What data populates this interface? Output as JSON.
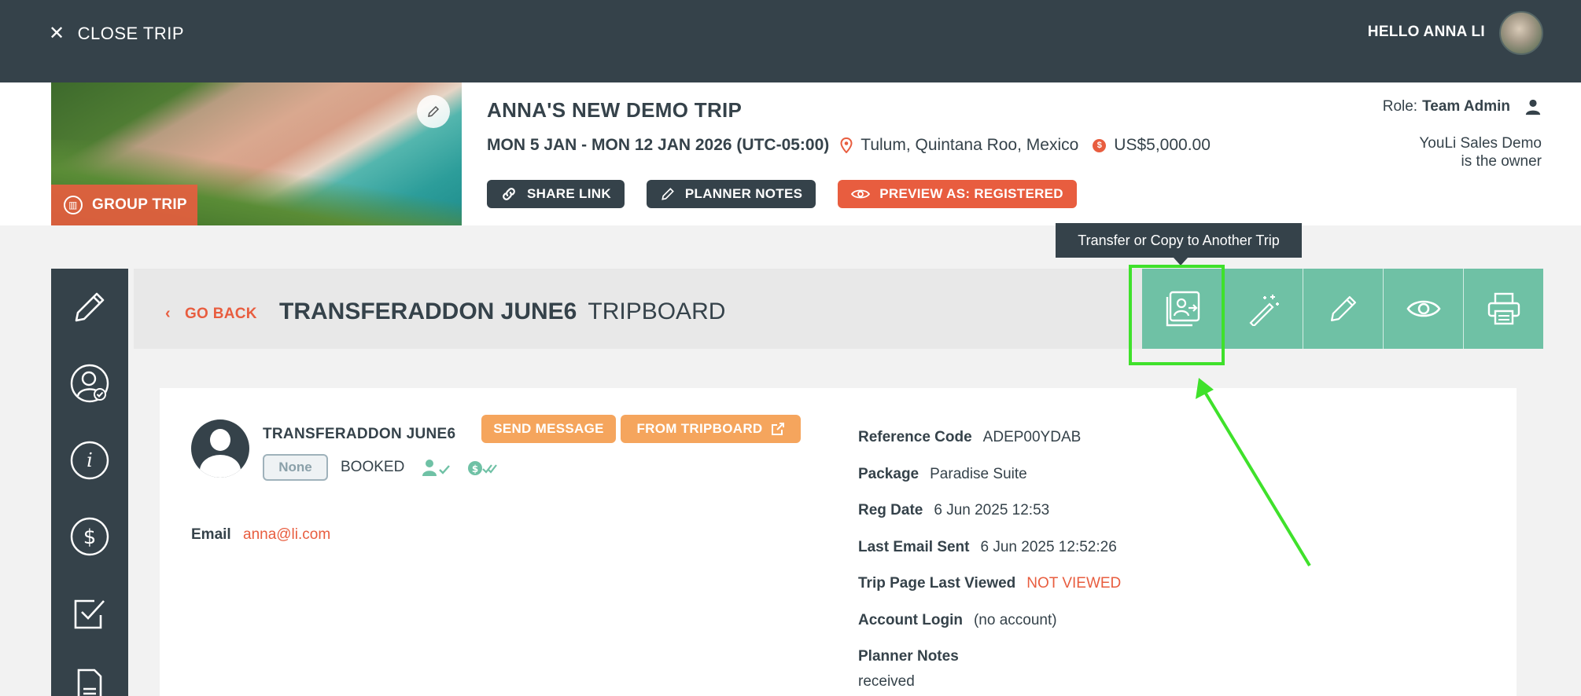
{
  "topbar": {
    "close_label": "CLOSE TRIP",
    "greeting": "HELLO ANNA LI"
  },
  "trip": {
    "title": "ANNA'S NEW DEMO TRIP",
    "dates": "MON 5 JAN - MON 12 JAN 2026 (UTC-05:00)",
    "location": "Tulum, Quintana Roo, Mexico",
    "price": "US$5,000.00",
    "group_badge": "GROUP TRIP",
    "buttons": {
      "share": "SHARE LINK",
      "notes": "PLANNER NOTES",
      "preview": "PREVIEW AS: REGISTERED"
    },
    "role_label": "Role:",
    "role_value": "Team Admin",
    "owner_line1": "YouLi Sales Demo",
    "owner_line2": "is the owner"
  },
  "tooltip": {
    "text": "Transfer or Copy to Another Trip"
  },
  "sidebar": {
    "icons": [
      "pencil-icon",
      "user-check-icon",
      "info-icon",
      "dollar-icon",
      "checkbox-icon",
      "document-icon"
    ]
  },
  "tripboard": {
    "go_back": "GO BACK",
    "title_bold": "TRANSFERADDON JUNE6",
    "title_rest": "TRIPBOARD",
    "actions": [
      "transfer-icon",
      "magic-wand-icon",
      "pencil-icon",
      "eye-icon",
      "printer-icon"
    ]
  },
  "registrant": {
    "name": "TRANSFERADDON JUNE6",
    "send_message": "SEND MESSAGE",
    "from_tripboard": "FROM TRIPBOARD",
    "badge": "None",
    "status": "BOOKED",
    "email_label": "Email",
    "email": "anna@li.com"
  },
  "details": [
    {
      "label": "Reference Code",
      "value": "ADEP00YDAB"
    },
    {
      "label": "Package",
      "value": "Paradise Suite"
    },
    {
      "label": "Reg Date",
      "value": "6 Jun 2025 12:53"
    },
    {
      "label": "Last Email Sent",
      "value": "6 Jun 2025 12:52:26"
    },
    {
      "label": "Trip Page Last Viewed",
      "value": "NOT VIEWED"
    },
    {
      "label": "Account Login",
      "value": "(no account)"
    },
    {
      "label": "Planner Notes",
      "value": ""
    }
  ],
  "planner_notes_value": "received",
  "colors": {
    "dark": "#35424a",
    "accent_red": "#e85d3f",
    "teal": "#6fc1a5",
    "orange": "#f5a55d",
    "highlight": "#3fe12b"
  }
}
